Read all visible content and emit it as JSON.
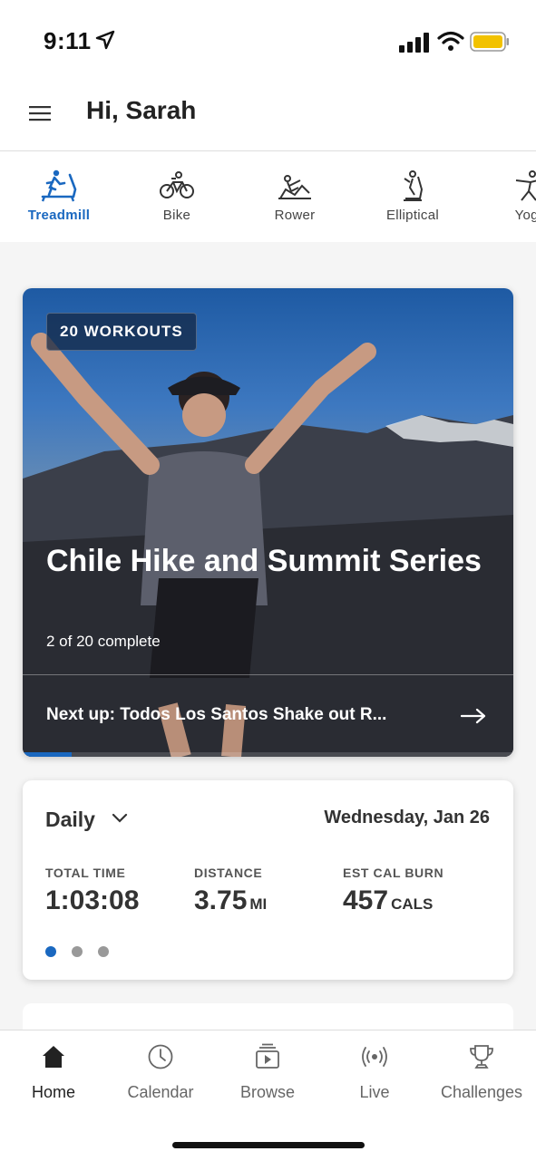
{
  "status_bar": {
    "time": "9:11"
  },
  "header": {
    "greeting": "Hi, Sarah"
  },
  "categories": [
    {
      "label": "Treadmill",
      "icon": "treadmill-icon",
      "active": true
    },
    {
      "label": "Bike",
      "icon": "bike-icon",
      "active": false
    },
    {
      "label": "Rower",
      "icon": "rower-icon",
      "active": false
    },
    {
      "label": "Elliptical",
      "icon": "elliptical-icon",
      "active": false
    },
    {
      "label": "Yoga",
      "icon": "yoga-icon",
      "active": false
    }
  ],
  "hero": {
    "badge": "20 WORKOUTS",
    "title": "Chile Hike and Summit Series",
    "progress_text": "2 of 20 complete",
    "progress_fraction": 0.1,
    "next_up": "Next up: Todos Los Santos Shake out R..."
  },
  "stats": {
    "period": "Daily",
    "date": "Wednesday, Jan 26",
    "items": [
      {
        "label": "TOTAL TIME",
        "value": "1:03:08",
        "unit": ""
      },
      {
        "label": "DISTANCE",
        "value": "3.75",
        "unit": "MI"
      },
      {
        "label": "EST CAL BURN",
        "value": "457",
        "unit": "CALS"
      }
    ],
    "page_count": 3,
    "active_page": 0
  },
  "bottom_nav": [
    {
      "label": "Home",
      "icon": "home-icon",
      "active": true
    },
    {
      "label": "Calendar",
      "icon": "clock-icon",
      "active": false
    },
    {
      "label": "Browse",
      "icon": "browse-icon",
      "active": false
    },
    {
      "label": "Live",
      "icon": "live-broadcast-icon",
      "active": false
    },
    {
      "label": "Challenges",
      "icon": "trophy-icon",
      "active": false
    }
  ],
  "colors": {
    "accent": "#1a68c0",
    "text": "#222222",
    "background": "#f5f5f5"
  }
}
